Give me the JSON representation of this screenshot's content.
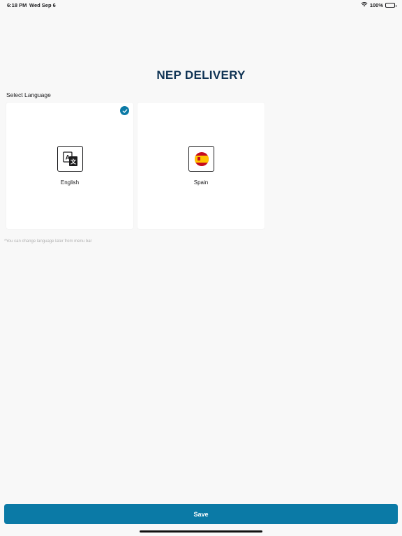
{
  "status_bar": {
    "time": "6:18 PM",
    "date": "Wed Sep 6",
    "battery": "100%",
    "battery_level": 1.0
  },
  "header": {
    "title": "NEP DELIVERY"
  },
  "language_section": {
    "label": "Select Language",
    "options": [
      {
        "label": "English",
        "icon": "translate-icon",
        "selected": true
      },
      {
        "label": "Spain",
        "icon": "spain-flag-icon",
        "selected": false
      }
    ],
    "hint": "*You can change language later from menu bar"
  },
  "footer": {
    "save_label": "Save"
  },
  "colors": {
    "accent": "#0b7aa6",
    "title": "#0f3354",
    "background": "#f8f8f8"
  }
}
